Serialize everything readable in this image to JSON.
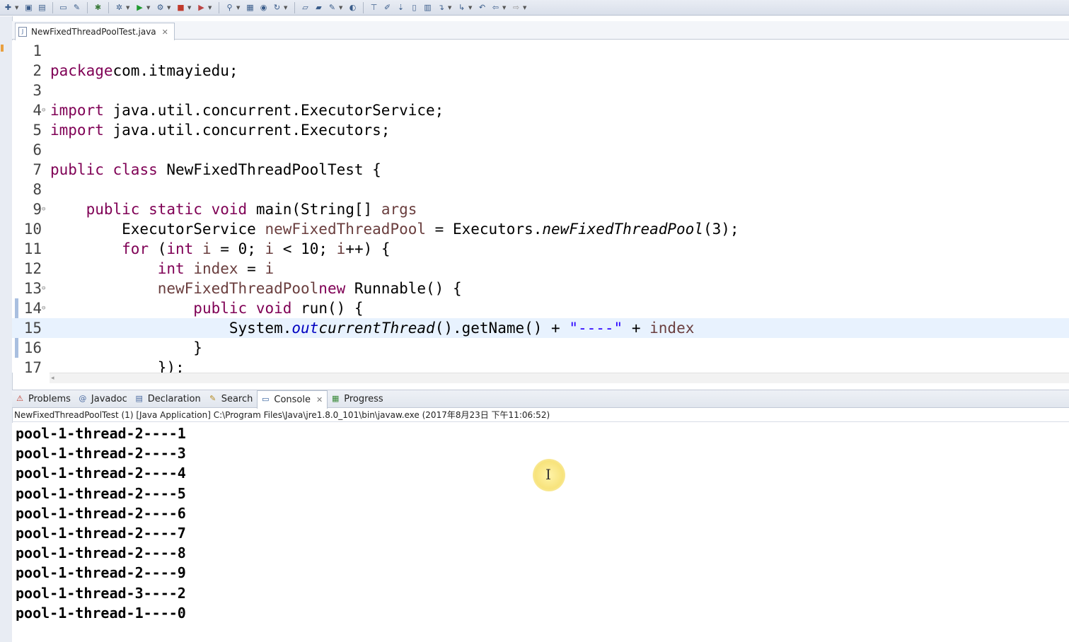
{
  "toolbar": {
    "icons": [
      "new-icon",
      "save-icon",
      "save-all-icon",
      "print-icon",
      "debug-icon",
      "run-icon",
      "external-tools-icon",
      "stop-icon",
      "search-icon",
      "open-type-icon",
      "navigate-back-icon",
      "navigate-forward-icon"
    ]
  },
  "editor": {
    "tab_label": "NewFixedThreadPoolTest.java",
    "lines": [
      {
        "n": "1",
        "fold": false,
        "tokens": []
      },
      {
        "n": "2",
        "fold": false,
        "tokens": [
          [
            "kw",
            "package"
          ],
          [
            "",
            "com.itmayiedu;"
          ]
        ]
      },
      {
        "n": "3",
        "fold": false,
        "tokens": []
      },
      {
        "n": "4",
        "fold": true,
        "tokens": [
          [
            "kw",
            "import"
          ],
          [
            "",
            " java.util.concurrent.ExecutorService;"
          ]
        ]
      },
      {
        "n": "5",
        "fold": false,
        "tokens": [
          [
            "kw",
            "import"
          ],
          [
            "",
            " java.util.concurrent.Executors;"
          ]
        ]
      },
      {
        "n": "6",
        "fold": false,
        "tokens": []
      },
      {
        "n": "7",
        "fold": false,
        "tokens": [
          [
            "kw",
            "public"
          ],
          [
            "",
            " "
          ],
          [
            "kw",
            "class"
          ],
          [
            "",
            " NewFixedThreadPoolTest {"
          ]
        ]
      },
      {
        "n": "8",
        "fold": false,
        "tokens": []
      },
      {
        "n": "9",
        "fold": true,
        "tokens": [
          [
            "",
            "    "
          ],
          [
            "kw",
            "public"
          ],
          [
            "",
            " "
          ],
          [
            "kw",
            "static"
          ],
          [
            "",
            " "
          ],
          [
            "kw",
            "void"
          ],
          [
            "",
            " main(String[] "
          ],
          [
            "var",
            "args"
          ],
          [
            ") {"
          ]
        ]
      },
      {
        "n": "10",
        "fold": false,
        "tokens": [
          [
            "",
            "        ExecutorService "
          ],
          [
            "var",
            "newFixedThreadPool"
          ],
          [
            "",
            " = Executors."
          ],
          [
            "mthd-static",
            "newFixedThreadPool"
          ],
          [
            "",
            "(3);"
          ]
        ]
      },
      {
        "n": "11",
        "fold": false,
        "tokens": [
          [
            "",
            "        "
          ],
          [
            "kw",
            "for"
          ],
          [
            "",
            " ("
          ],
          [
            "kw",
            "int"
          ],
          [
            "",
            " "
          ],
          [
            "var",
            "i"
          ],
          [
            "",
            " = 0; "
          ],
          [
            "var",
            "i"
          ],
          [
            "",
            " < 10; "
          ],
          [
            "var",
            "i"
          ],
          [
            "",
            "++) {"
          ]
        ]
      },
      {
        "n": "12",
        "fold": false,
        "tokens": [
          [
            "",
            "            "
          ],
          [
            "kw",
            "int"
          ],
          [
            "",
            " "
          ],
          [
            "var",
            "index"
          ],
          [
            "",
            " = "
          ],
          [
            "var",
            "i"
          ],
          [
            ";"
          ]
        ]
      },
      {
        "n": "13",
        "fold": true,
        "tokens": [
          [
            "",
            "            "
          ],
          [
            "var",
            "newFixedThreadPool"
          ],
          [
            ".execute("
          ],
          [
            "kw",
            "new"
          ],
          [
            "",
            " Runnable() {"
          ]
        ]
      },
      {
        "n": "14",
        "fold": true,
        "tokens": [
          [
            "",
            "                "
          ],
          [
            "kw",
            "public"
          ],
          [
            "",
            " "
          ],
          [
            "kw",
            "void"
          ],
          [
            "",
            " run() {"
          ]
        ]
      },
      {
        "n": "15",
        "fold": false,
        "current": true,
        "tokens": [
          [
            "",
            "                    System."
          ],
          [
            "fld",
            "out"
          ],
          [
            ".println(Thread."
          ],
          [
            "mthd-static",
            "currentThread"
          ],
          [
            "",
            "().getName() + "
          ],
          [
            "str",
            "\"----\""
          ],
          [
            "",
            " + "
          ],
          [
            "var",
            "index"
          ],
          [
            ");"
          ]
        ]
      },
      {
        "n": "16",
        "fold": false,
        "tokens": [
          [
            "",
            "                }"
          ]
        ]
      },
      {
        "n": "17",
        "fold": false,
        "tokens": [
          [
            "",
            "            });"
          ]
        ]
      }
    ]
  },
  "panel": {
    "tabs": [
      {
        "id": "problems",
        "label": "Problems",
        "icon": "problems-icon",
        "glyph": "⚠",
        "color": "#c0392b"
      },
      {
        "id": "javadoc",
        "label": "Javadoc",
        "icon": "javadoc-icon",
        "glyph": "@",
        "color": "#4a6aa0"
      },
      {
        "id": "declaration",
        "label": "Declaration",
        "icon": "declaration-icon",
        "glyph": "▤",
        "color": "#4a6aa0"
      },
      {
        "id": "search",
        "label": "Search",
        "icon": "search-flashlight-icon",
        "glyph": "✎",
        "color": "#b58a20"
      },
      {
        "id": "console",
        "label": "Console",
        "icon": "console-icon",
        "glyph": "▭",
        "color": "#2d5b9a",
        "active": true
      },
      {
        "id": "progress",
        "label": "Progress",
        "icon": "progress-icon",
        "glyph": "▦",
        "color": "#3a8a3a"
      }
    ],
    "console_header": "NewFixedThreadPoolTest (1) [Java Application] C:\\Program Files\\Java\\jre1.8.0_101\\bin\\javaw.exe (2017年8月23日 下午11:06:52)",
    "output": [
      "pool-1-thread-2----1",
      "pool-1-thread-2----3",
      "pool-1-thread-2----4",
      "pool-1-thread-2----5",
      "pool-1-thread-2----6",
      "pool-1-thread-2----7",
      "pool-1-thread-2----8",
      "pool-1-thread-2----9",
      "pool-1-thread-3----2",
      "pool-1-thread-1----0"
    ]
  }
}
